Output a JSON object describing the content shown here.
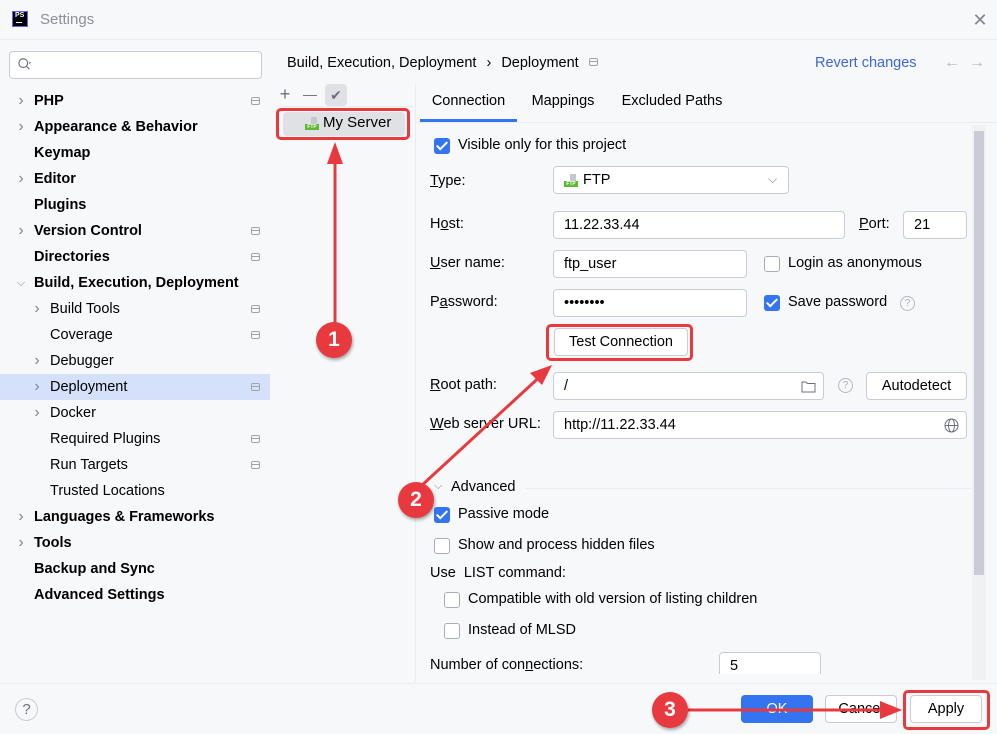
{
  "window": {
    "title": "Settings",
    "app_logo": "PS",
    "close_icon": "close-icon"
  },
  "search": {
    "value": "",
    "placeholder": ""
  },
  "sidebar": {
    "items": [
      {
        "label": "PHP",
        "level": 0,
        "expandable": true,
        "expanded": false,
        "project_icon": true
      },
      {
        "label": "Appearance & Behavior",
        "level": 0,
        "expandable": true,
        "expanded": false,
        "project_icon": false
      },
      {
        "label": "Keymap",
        "level": 0,
        "expandable": false,
        "project_icon": false
      },
      {
        "label": "Editor",
        "level": 0,
        "expandable": true,
        "expanded": false,
        "project_icon": false
      },
      {
        "label": "Plugins",
        "level": 0,
        "expandable": false,
        "project_icon": false
      },
      {
        "label": "Version Control",
        "level": 0,
        "expandable": true,
        "expanded": false,
        "project_icon": true
      },
      {
        "label": "Directories",
        "level": 0,
        "expandable": false,
        "project_icon": true
      },
      {
        "label": "Build, Execution, Deployment",
        "level": 0,
        "expandable": true,
        "expanded": true,
        "project_icon": false
      },
      {
        "label": "Build Tools",
        "level": 1,
        "expandable": true,
        "expanded": false,
        "project_icon": true
      },
      {
        "label": "Coverage",
        "level": 1,
        "expandable": false,
        "project_icon": true
      },
      {
        "label": "Debugger",
        "level": 1,
        "expandable": true,
        "expanded": false,
        "project_icon": false
      },
      {
        "label": "Deployment",
        "level": 1,
        "expandable": true,
        "expanded": false,
        "project_icon": true,
        "selected": true
      },
      {
        "label": "Docker",
        "level": 1,
        "expandable": true,
        "expanded": false,
        "project_icon": false
      },
      {
        "label": "Required Plugins",
        "level": 1,
        "expandable": false,
        "project_icon": true
      },
      {
        "label": "Run Targets",
        "level": 1,
        "expandable": false,
        "project_icon": true
      },
      {
        "label": "Trusted Locations",
        "level": 1,
        "expandable": false,
        "project_icon": false
      },
      {
        "label": "Languages & Frameworks",
        "level": 0,
        "expandable": true,
        "expanded": false,
        "project_icon": false
      },
      {
        "label": "Tools",
        "level": 0,
        "expandable": true,
        "expanded": false,
        "project_icon": false
      },
      {
        "label": "Backup and Sync",
        "level": 0,
        "expandable": false,
        "project_icon": false
      },
      {
        "label": "Advanced Settings",
        "level": 0,
        "expandable": false,
        "project_icon": false
      }
    ]
  },
  "header": {
    "breadcrumb": [
      "Build, Execution, Deployment",
      "Deployment"
    ],
    "breadcrumb_separator": "›",
    "revert_label": "Revert changes",
    "back_icon": "←",
    "forward_icon": "→"
  },
  "servers": {
    "toolbar": {
      "add": "+",
      "remove": "—",
      "default": "✔"
    },
    "items": [
      {
        "name": "My Server",
        "type_icon": "FTP",
        "selected": true
      }
    ]
  },
  "tabs": [
    {
      "label": "Connection",
      "active": true
    },
    {
      "label": "Mappings",
      "active": false
    },
    {
      "label": "Excluded Paths",
      "active": false
    }
  ],
  "connection": {
    "visible_only": {
      "label": "Visible only for this project",
      "checked": true
    },
    "type": {
      "label_pre": "",
      "label_u": "T",
      "label_post": "ype:",
      "value": "FTP",
      "icon": "FTP"
    },
    "host": {
      "label_pre": "H",
      "label_u": "o",
      "label_post": "st:",
      "value": "11.22.33.44"
    },
    "port": {
      "label_u": "P",
      "label_post": "ort:",
      "value": "21"
    },
    "user": {
      "label_u": "U",
      "label_post": "ser name:",
      "value": "ftp_user"
    },
    "anonymous": {
      "label": "Login as anonymous",
      "checked": false
    },
    "password": {
      "label_pre": "P",
      "label_u": "a",
      "label_post": "ssword:",
      "value": "••••••••"
    },
    "save_password": {
      "label": "Save password",
      "checked": true
    },
    "test_connection_label": "Test Connection",
    "root_path": {
      "label_u": "R",
      "label_post": "oot path:",
      "value": "/"
    },
    "autodetect_label": "Autodetect",
    "web_url": {
      "label_u": "W",
      "label_post": "eb server URL:",
      "value": "http://11.22.33.44"
    }
  },
  "advanced": {
    "title": "Advanced",
    "passive_mode": {
      "label": "Passive mode",
      "checked": true
    },
    "hidden_files": {
      "label": "Show and process hidden files",
      "checked": false
    },
    "list_command_label": "Use  LIST command:",
    "compat_old": {
      "label": "Compatible with old version of listing children",
      "checked": false
    },
    "instead_mlsd": {
      "label": "Instead of MLSD",
      "checked": false
    },
    "connections": {
      "label_pre": "Number of con",
      "label_u": "n",
      "label_post": "ections:",
      "value": "5"
    }
  },
  "footer": {
    "help": "?",
    "ok_label": "OK",
    "cancel_label": "Cancel",
    "apply_label": "Apply"
  },
  "annotations": {
    "color": "#e8393e",
    "badges": [
      "1",
      "2",
      "3"
    ]
  }
}
